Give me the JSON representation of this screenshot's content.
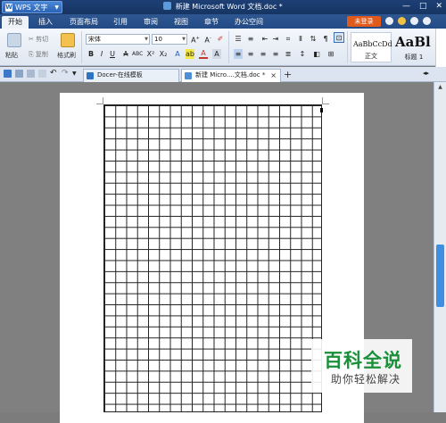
{
  "titlebar": {
    "app_menu_label": "WPS 文字",
    "document_title": "新建 Microsoft Word 文档.doc *"
  },
  "menu": {
    "tabs": [
      "开始",
      "插入",
      "页面布局",
      "引用",
      "审阅",
      "视图",
      "章节",
      "办公空间"
    ],
    "active_tab": "开始",
    "login_label": "未登录"
  },
  "ribbon": {
    "paste_label": "粘贴",
    "cut_label": "剪切",
    "copy_label": "复制",
    "format_painter_label": "格式刷",
    "font_name": "宋体",
    "font_size": "10",
    "style_normal_sample": "AaBbCcDd",
    "style_normal_name": "正文",
    "style_heading_sample": "AaBl",
    "style_heading_name": "标题 1"
  },
  "doc_tabs": [
    {
      "label": "Docer-在线模板",
      "active": false
    },
    {
      "label": "新建 Micro....文档.doc *",
      "active": true
    }
  ],
  "watermark": {
    "brand": "百科全说",
    "tagline": "助你轻松解决"
  },
  "colors": {
    "title_bar": "#163563",
    "menu_bar": "#234b85",
    "login_button": "#e05a1c",
    "watermark_green": "#1a8f3a",
    "scroll_thumb": "#3f8ee0"
  }
}
